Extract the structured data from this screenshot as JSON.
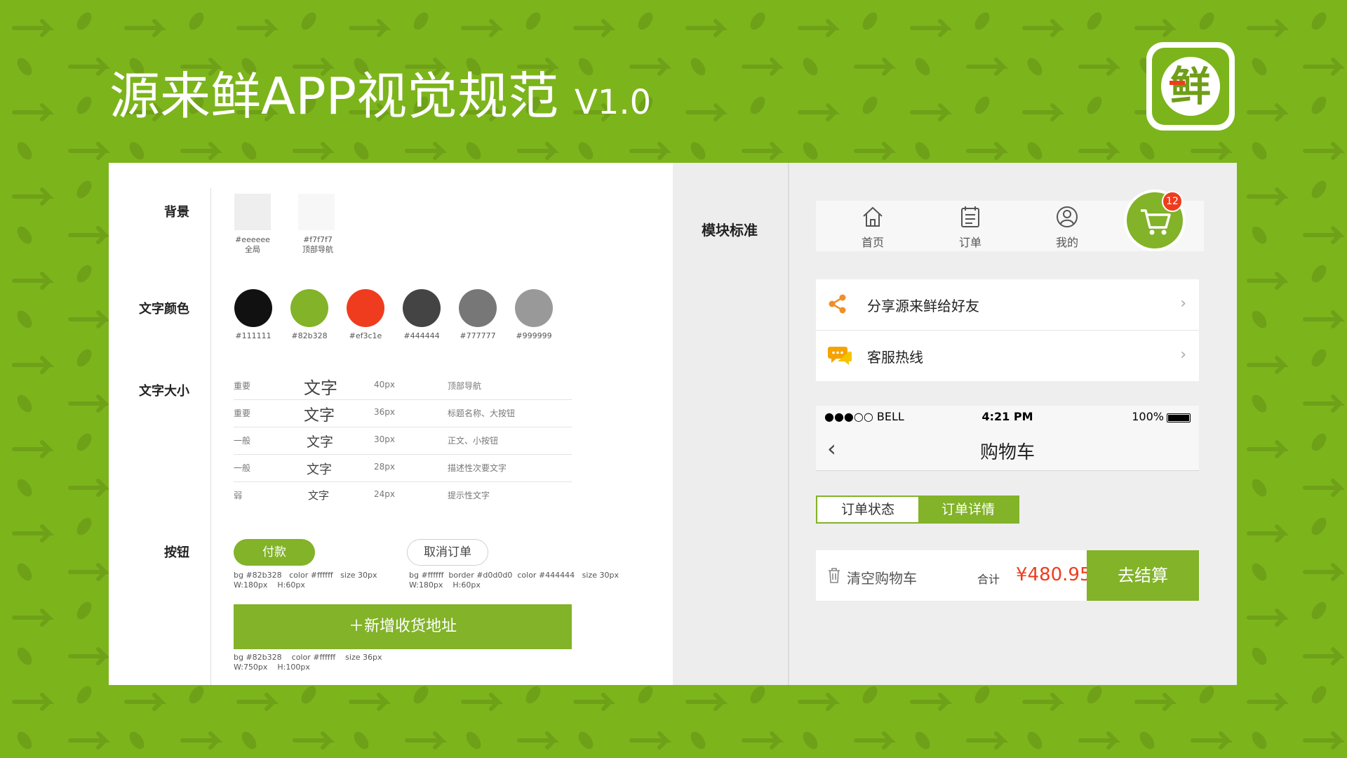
{
  "header": {
    "title": "源来鲜APP视觉规范",
    "version": "V1.0",
    "logo_glyph": "鲜"
  },
  "colors": {
    "brand_green": "#82b328",
    "bg_green": "#7cb41c",
    "accent_red": "#ef3c1e"
  },
  "sections": {
    "background": "背景",
    "text_color": "文字颜色",
    "text_size": "文字大小",
    "buttons": "按钮",
    "module": "模块标准"
  },
  "bg_swatches": [
    {
      "hex": "#eeeeee",
      "label": "全局"
    },
    {
      "hex": "#f7f7f7",
      "label": "顶部导航"
    }
  ],
  "text_colors": [
    "#111111",
    "#82b328",
    "#ef3c1e",
    "#444444",
    "#777777",
    "#999999"
  ],
  "text_sizes": [
    {
      "weight": "重要",
      "sample": "文字",
      "px": "40px",
      "desc": "顶部导航"
    },
    {
      "weight": "重要",
      "sample": "文字",
      "px": "36px",
      "desc": "标题名称、大按钮"
    },
    {
      "weight": "一般",
      "sample": "文字",
      "px": "30px",
      "desc": "正文、小按钮"
    },
    {
      "weight": "一般",
      "sample": "文字",
      "px": "28px",
      "desc": "描述性次要文字"
    },
    {
      "weight": "弱",
      "sample": "文字",
      "px": "24px",
      "desc": "提示性文字"
    }
  ],
  "buttons": {
    "pay": "付款",
    "pay_spec": "bg #82b328   color #ffffff   size 30px\nW:180px    H:60px",
    "cancel": "取消订单",
    "cancel_spec": "bg #ffffff  border #d0d0d0  color #444444   size 30px\nW:180px    H:60px",
    "add_address": "＋新增收货地址",
    "add_address_spec": "bg #82b328    color #ffffff    size 36px\nW:750px    H:100px"
  },
  "tabbar": {
    "items": [
      "首页",
      "订单",
      "我的"
    ],
    "cart_badge": "12"
  },
  "list": {
    "share": "分享源来鲜给好友",
    "hotline": "客服热线",
    "chevron": "›"
  },
  "phone": {
    "carrier": "●●●○○ BELL",
    "time": "4:21 PM",
    "battery": "100%",
    "title": "购物车",
    "back": "‹"
  },
  "segment": {
    "status": "订单状态",
    "detail": "订单详情"
  },
  "checkout": {
    "clear": "清空购物车",
    "total_label": "合计",
    "total": "¥480.95",
    "go": "去结算"
  }
}
